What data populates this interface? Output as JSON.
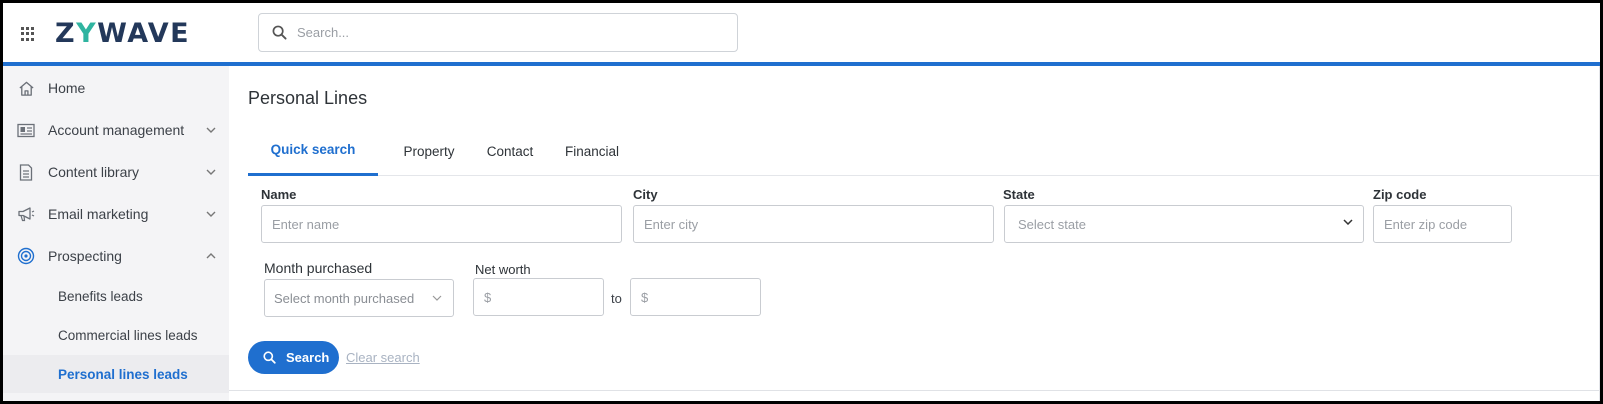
{
  "brand": {
    "logo_left": "Z",
    "logo_slash": "Y",
    "logo_right": "WAVE",
    "accent_color": "#1f6fcf",
    "logo_color": "#23385a",
    "slash_color": "#2fb4a0"
  },
  "header": {
    "search_placeholder": "Search..."
  },
  "sidebar": {
    "items": [
      {
        "label": "Home",
        "icon": "home-icon",
        "chevron": ""
      },
      {
        "label": "Account management",
        "icon": "id-card-icon",
        "chevron": "down"
      },
      {
        "label": "Content library",
        "icon": "document-icon",
        "chevron": "down"
      },
      {
        "label": "Email marketing",
        "icon": "megaphone-icon",
        "chevron": "down"
      },
      {
        "label": "Prospecting",
        "icon": "target-icon",
        "chevron": "up"
      }
    ],
    "sub_items": [
      {
        "label": "Benefits leads",
        "active": false
      },
      {
        "label": "Commercial lines leads",
        "active": false
      },
      {
        "label": "Personal lines leads",
        "active": true
      }
    ]
  },
  "main": {
    "title": "Personal Lines",
    "tabs": [
      {
        "label": "Quick search",
        "active": true
      },
      {
        "label": "Property",
        "active": false
      },
      {
        "label": "Contact",
        "active": false
      },
      {
        "label": "Financial",
        "active": false
      }
    ],
    "form": {
      "name_label": "Name",
      "name_placeholder": "Enter name",
      "city_label": "City",
      "city_placeholder": "Enter city",
      "state_label": "State",
      "state_placeholder": "Select state",
      "zip_label": "Zip code",
      "zip_placeholder": "Enter zip code",
      "month_label": "Month purchased",
      "month_placeholder": "Select month purchased",
      "networth_label": "Net worth",
      "currency_symbol": "$",
      "to_label": "to"
    },
    "search_button": "Search",
    "clear_link": "Clear search"
  }
}
